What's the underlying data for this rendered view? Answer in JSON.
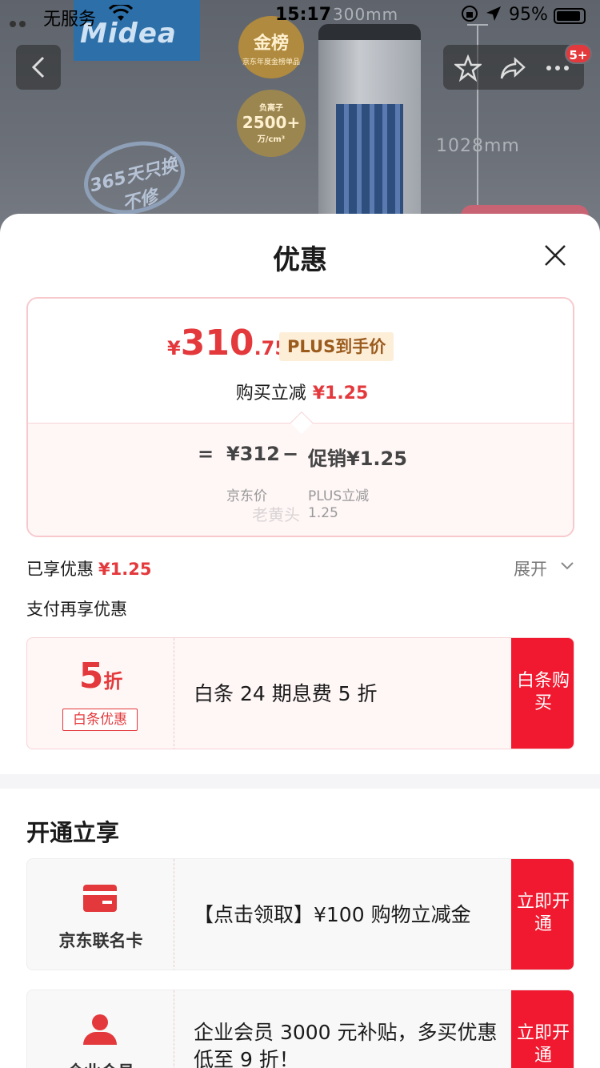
{
  "status_bar": {
    "carrier": "无服务",
    "time": "15:17",
    "battery": "95%"
  },
  "product_image": {
    "brand": "Midea",
    "badge_gold": "金榜",
    "badge_gold_sub": "京东年度金榜单品",
    "badge_ion_top": "负离子",
    "badge_ion_value": "2500+",
    "badge_ion_unit": "万/cm³",
    "seal": "365天只换不修",
    "dim_width": "300mm",
    "dim_height": "1028mm"
  },
  "nav": {
    "message_badge": "5+"
  },
  "sheet": {
    "title": "优惠",
    "price": {
      "currency": "¥",
      "integer": "310",
      "decimal": ".75",
      "tag": "PLUS到手价",
      "reduce_label": "购买立减",
      "reduce_amount": "¥1.25"
    },
    "formula": {
      "eq": "=",
      "jd_price": "¥312",
      "minus": "−",
      "promo": "促销¥1.25",
      "jd_label": "京东价",
      "plus_label": "PLUS立减",
      "plus_amount": "1.25",
      "watermark": "老黄头"
    },
    "enjoyed_label": "已享优惠",
    "enjoyed_amount": "¥1.25",
    "expand_label": "展开",
    "pay_title": "支付再享优惠",
    "baitiao": {
      "discount_num": "5",
      "discount_unit": "折",
      "tag": "白条优惠",
      "desc": "白条 24 期息费 5 折",
      "cta": "白条购买"
    },
    "open_title": "开通立享",
    "offers": [
      {
        "name": "京东联名卡",
        "desc": "【点击领取】¥100 购物立减金",
        "cta": "立即开通"
      },
      {
        "name": "企业会员",
        "desc": "企业会员 3000 元补贴，多买优惠低至 9 折！",
        "cta": "立即开通"
      }
    ]
  },
  "colors": {
    "accent_red": "#e4393c",
    "cta_red": "#f0192f",
    "plus_gold": "#9a5b1d"
  }
}
